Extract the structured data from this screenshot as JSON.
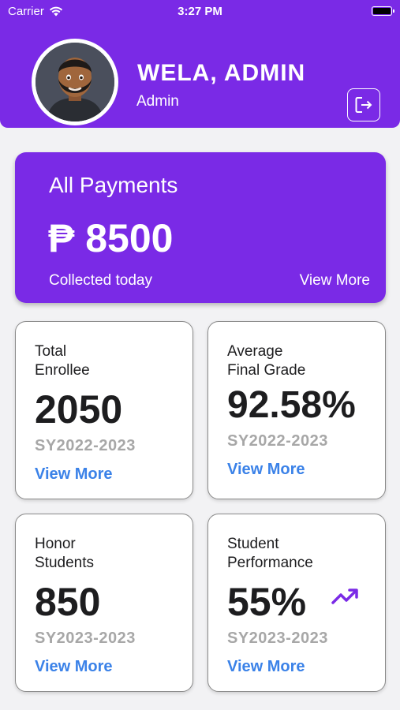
{
  "status_bar": {
    "carrier": "Carrier",
    "time": "3:27 PM",
    "wifi_icon": "wifi-icon",
    "battery_icon": "battery-icon"
  },
  "profile": {
    "name": "WELA, ADMIN",
    "role": "Admin",
    "avatar": "avatar-3d-bearded-man",
    "logout_icon": "logout-icon"
  },
  "payments": {
    "title": "All Payments",
    "amount": "₱ 8500",
    "note": "Collected today",
    "view_more": "View More"
  },
  "stats": [
    {
      "label": "Total\nEnrollee",
      "value": "2050",
      "sy": "SY2022-2023",
      "view_more": "View More"
    },
    {
      "label": "Average\nFinal Grade",
      "value": "92.58%",
      "sy": "SY2022-2023",
      "view_more": "View More"
    },
    {
      "label": "Honor\nStudents",
      "value": "850",
      "sy": "SY2023-2023",
      "view_more": "View More"
    },
    {
      "label": "Student\nPerformance",
      "value": "55%",
      "sy": "SY2023-2023",
      "view_more": "View More",
      "icon": "trending-up-icon"
    }
  ],
  "colors": {
    "primary": "#7a2ae6",
    "link": "#3b82e8",
    "muted": "#a7a7a7",
    "background": "#f2f2f4"
  }
}
